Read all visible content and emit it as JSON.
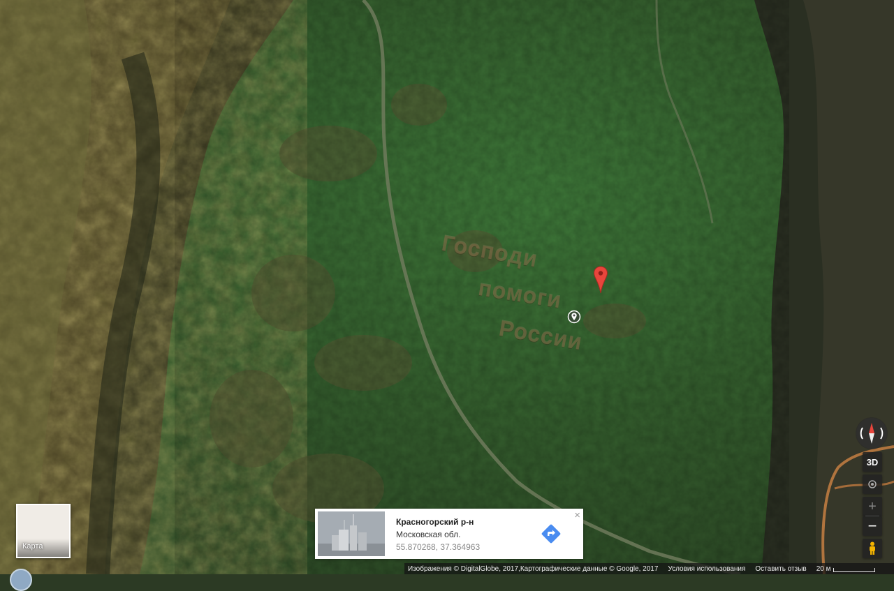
{
  "map": {
    "view": "satellite",
    "ground_text": [
      "Господи",
      "помоги",
      "России"
    ]
  },
  "map_type_toggle": {
    "label": "Карта"
  },
  "info_card": {
    "title": "Красногорский р-н",
    "subtitle": "Московская обл.",
    "coordinates": "55.870268, 37.364963"
  },
  "controls": {
    "three_d_label": "3D",
    "zoom_in_label": "+",
    "zoom_out_label": "−"
  },
  "footer": {
    "attribution": "Изображения © DigitalGlobe, 2017,Картографические данные © Google, 2017",
    "terms": "Условия использования",
    "feedback": "Оставить отзыв",
    "scale": "20 м"
  },
  "colors": {
    "marker_red": "#e8453c",
    "direction_blue": "#4a8cf0"
  }
}
